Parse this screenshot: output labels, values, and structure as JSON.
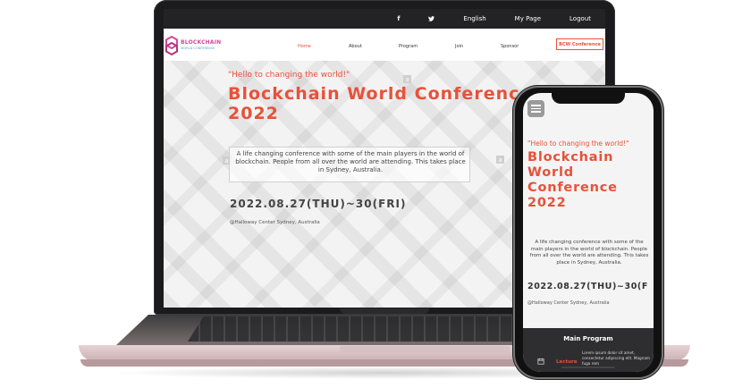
{
  "laptop_site": {
    "topbar": {
      "facebook_icon": "f",
      "twitter_icon": "🐦",
      "language": "English",
      "my_page": "My Page",
      "logout": "Logout"
    },
    "logo": {
      "name": "BLOCKCHAIN",
      "sub": "WORLD CONFERENCE"
    },
    "nav": {
      "home": "Home",
      "about": "About",
      "program": "Program",
      "join": "Join",
      "sponsor": "Sponsor",
      "cta": "BCW Conference"
    },
    "hero": {
      "tagline": "\"Hello to changing the world!\"",
      "title_line1": "Blockchain World Conference",
      "title_line2": "2022",
      "description": "A life changing conference with some of the main players in the world of blockchain. People from all over the world are attending. This takes place in Sydney, Australia.",
      "date": "2022.08.27(THU)~30(FRI)",
      "venue": "@Halloway Center Sydney, Australia",
      "badge": "a"
    }
  },
  "phone_site": {
    "hero": {
      "tagline": "\"Hello to changing the world!\"",
      "title_line1": "Blockchain",
      "title_line2": "World",
      "title_line3": "Conference",
      "title_line4": "2022",
      "description": "A life changing conference with some of the main players in the world of blockchain. People from all over the world are attending. This takes place in Sydney, Australia.",
      "date": "2022.08.27(THU)~30(F",
      "venue": "@Halloway Center Sydney, Australia"
    },
    "program": {
      "title": "Main Program",
      "item_label": "Lecture",
      "item_text": "Lorem ipsum dolor sit amet, consectetur adipiscing elit. Magnam fuga rem"
    }
  },
  "colors": {
    "accent": "#e8513a",
    "dark": "#232325",
    "logo_pink": "#d8479a"
  }
}
